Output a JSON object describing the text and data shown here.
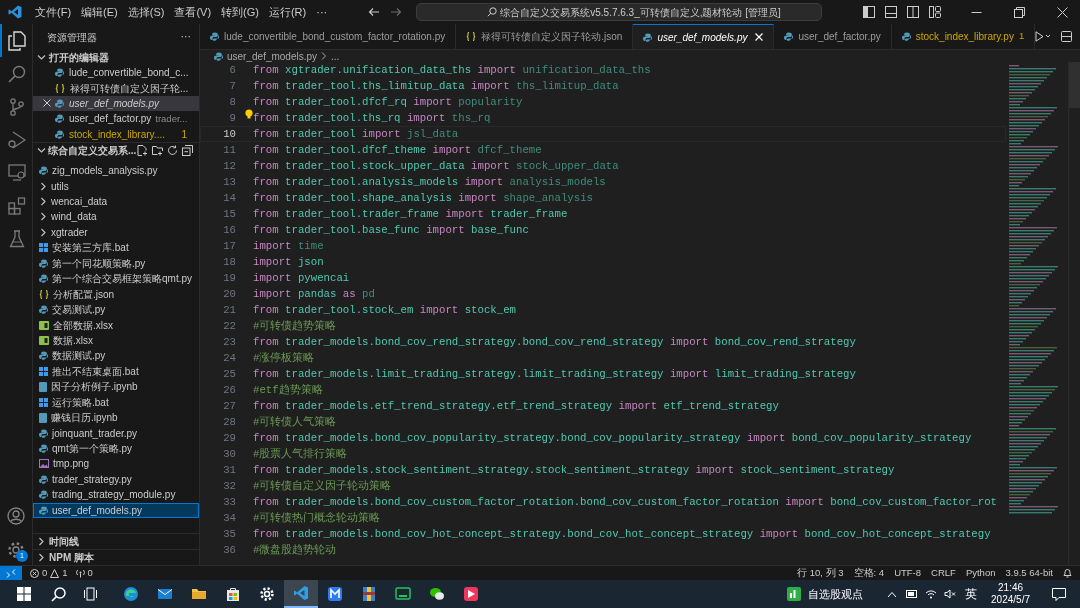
{
  "title_bar": {
    "menus": [
      "文件(F)",
      "编辑(E)",
      "选择(S)",
      "查看(V)",
      "转到(G)",
      "运行(R)",
      "···"
    ],
    "command_center": "综合自定义交易系统v5.5.7.6.3_可转债自定义,题材轮动 [管理员]"
  },
  "activity_bar": {
    "items": [
      {
        "kind": "files",
        "selected": true
      },
      {
        "kind": "search",
        "selected": false
      },
      {
        "kind": "scm",
        "selected": false
      },
      {
        "kind": "debug",
        "selected": false
      },
      {
        "kind": "remote",
        "selected": false
      },
      {
        "kind": "extensions",
        "selected": false
      },
      {
        "kind": "testing",
        "selected": false
      }
    ],
    "settings_badge": "1"
  },
  "sidebar": {
    "title": "资源管理器",
    "more": "···",
    "open_editors": {
      "title": "打开的编辑器",
      "items": [
        {
          "name": "lude_convertible_bond_c...",
          "kind": "py",
          "selected": false,
          "preview": false,
          "warning": false
        },
        {
          "name": "禄得可转债自定义因子轮...",
          "kind": "json",
          "selected": false,
          "preview": false,
          "warning": false
        },
        {
          "name": "user_def_models.py",
          "kind": "py",
          "selected": true,
          "preview": true,
          "warning": false
        },
        {
          "name": "user_def_factor.py",
          "description": "trader...",
          "kind": "py",
          "selected": false,
          "preview": false,
          "warning": false
        },
        {
          "name": "stock_index_library....",
          "problems": "1",
          "kind": "py",
          "selected": false,
          "preview": false,
          "warning": true
        }
      ]
    },
    "folder": {
      "title": "综合自定义交易系...",
      "items": [
        {
          "name": "zig_models_analysis.py",
          "kind": "py",
          "selected": false
        },
        {
          "name": "utils",
          "kind": "folder",
          "selected": false
        },
        {
          "name": "wencai_data",
          "kind": "folder",
          "selected": false
        },
        {
          "name": "wind_data",
          "kind": "folder",
          "selected": false
        },
        {
          "name": "xgtrader",
          "kind": "folder",
          "selected": false
        },
        {
          "name": "安装第三方库.bat",
          "kind": "bat",
          "selected": false
        },
        {
          "name": "第一个同花顺策略.py",
          "kind": "py",
          "selected": false
        },
        {
          "name": "第一个综合交易框架策略qmt.py",
          "kind": "py",
          "selected": false
        },
        {
          "name": "分析配置.json",
          "kind": "json",
          "selected": false
        },
        {
          "name": "交易测试.py",
          "kind": "py",
          "selected": false
        },
        {
          "name": "全部数据.xlsx",
          "kind": "xlsx",
          "selected": false
        },
        {
          "name": "数据.xlsx",
          "kind": "xlsx",
          "selected": false
        },
        {
          "name": "数据测试.py",
          "kind": "py",
          "selected": false
        },
        {
          "name": "推出不结束桌面.bat",
          "kind": "bat",
          "selected": false
        },
        {
          "name": "因子分析例子.ipynb",
          "kind": "ipynb",
          "selected": false
        },
        {
          "name": "运行策略.bat",
          "kind": "bat",
          "selected": false
        },
        {
          "name": "赚钱日历.ipynb",
          "kind": "ipynb",
          "selected": false
        },
        {
          "name": "joinquant_trader.py",
          "kind": "py",
          "selected": false
        },
        {
          "name": "qmt第一个策略.py",
          "kind": "py",
          "selected": false
        },
        {
          "name": "tmp.png",
          "kind": "png",
          "selected": false
        },
        {
          "name": "trader_strategy.py",
          "kind": "py",
          "selected": false
        },
        {
          "name": "trading_strategy_module.py",
          "kind": "py",
          "selected": false
        },
        {
          "name": "user_def_models.py",
          "kind": "py",
          "selected": true
        }
      ]
    },
    "panels": [
      "时间线",
      "NPM 脚本"
    ]
  },
  "tabs": [
    {
      "label": "lude_convertible_bond_custom_factor_rotation.py",
      "kind": "py",
      "selected": false,
      "warning": false
    },
    {
      "label": "禄得可转债自定义因子轮动.json",
      "kind": "json",
      "selected": false,
      "warning": false
    },
    {
      "label": "user_def_models.py",
      "kind": "py",
      "selected": true,
      "warning": false
    },
    {
      "label": "user_def_factor.py",
      "kind": "py",
      "selected": false,
      "warning": false
    },
    {
      "label": "stock_index_library.py",
      "problems": "1",
      "kind": "py",
      "selected": false,
      "warning": true
    }
  ],
  "breadcrumb": [
    "user_def_models.py",
    "..."
  ],
  "code": [
    {
      "number": "6",
      "current": false,
      "lightbulb": false,
      "tokens": [
        {
          "kind": "keyword",
          "text": "from"
        },
        {
          "kind": "module",
          "text": "xgtrader.unification_data_ths"
        },
        {
          "kind": "keyword",
          "text": "import"
        },
        {
          "kind": "unused",
          "text": "unification_data_ths"
        }
      ]
    },
    {
      "number": "7",
      "current": false,
      "lightbulb": false,
      "tokens": [
        {
          "kind": "keyword",
          "text": "from"
        },
        {
          "kind": "module",
          "text": "trader_tool.ths_limitup_data"
        },
        {
          "kind": "keyword",
          "text": "import"
        },
        {
          "kind": "unused",
          "text": "ths_limitup_data"
        }
      ]
    },
    {
      "number": "8",
      "current": false,
      "lightbulb": false,
      "tokens": [
        {
          "kind": "keyword",
          "text": "from"
        },
        {
          "kind": "module",
          "text": "trader_tool.dfcf_rq"
        },
        {
          "kind": "keyword",
          "text": "import"
        },
        {
          "kind": "unused",
          "text": "popularity"
        }
      ]
    },
    {
      "number": "9",
      "current": false,
      "lightbulb": true,
      "tokens": [
        {
          "kind": "keyword",
          "text": "from"
        },
        {
          "kind": "module",
          "text": "trader_tool.ths_rq"
        },
        {
          "kind": "keyword",
          "text": "import"
        },
        {
          "kind": "unused",
          "text": "ths_rq"
        }
      ]
    },
    {
      "number": "10",
      "current": true,
      "lightbulb": false,
      "tokens": [
        {
          "kind": "keyword",
          "text": "from"
        },
        {
          "kind": "module",
          "text": "trader_tool"
        },
        {
          "kind": "keyword",
          "text": "import"
        },
        {
          "kind": "unused",
          "text": "jsl_data"
        }
      ]
    },
    {
      "number": "11",
      "current": false,
      "lightbulb": false,
      "tokens": [
        {
          "kind": "keyword",
          "text": "from"
        },
        {
          "kind": "module",
          "text": "trader_tool.dfcf_theme"
        },
        {
          "kind": "keyword",
          "text": "import"
        },
        {
          "kind": "unused",
          "text": "dfcf_theme"
        }
      ]
    },
    {
      "number": "12",
      "current": false,
      "lightbulb": false,
      "tokens": [
        {
          "kind": "keyword",
          "text": "from"
        },
        {
          "kind": "module",
          "text": "trader_tool.stock_upper_data"
        },
        {
          "kind": "keyword",
          "text": "import"
        },
        {
          "kind": "unused",
          "text": "stock_upper_data"
        }
      ]
    },
    {
      "number": "13",
      "current": false,
      "lightbulb": false,
      "tokens": [
        {
          "kind": "keyword",
          "text": "from"
        },
        {
          "kind": "module",
          "text": "trader_tool.analysis_models"
        },
        {
          "kind": "keyword",
          "text": "import"
        },
        {
          "kind": "unused",
          "text": "analysis_models"
        }
      ]
    },
    {
      "number": "14",
      "current": false,
      "lightbulb": false,
      "tokens": [
        {
          "kind": "keyword",
          "text": "from"
        },
        {
          "kind": "module",
          "text": "trader_tool.shape_analysis"
        },
        {
          "kind": "keyword",
          "text": "import"
        },
        {
          "kind": "unused",
          "text": "shape_analysis"
        }
      ]
    },
    {
      "number": "15",
      "current": false,
      "lightbulb": false,
      "tokens": [
        {
          "kind": "keyword",
          "text": "from"
        },
        {
          "kind": "module",
          "text": "trader_tool.trader_frame"
        },
        {
          "kind": "keyword",
          "text": "import"
        },
        {
          "kind": "module",
          "text": "trader_frame"
        }
      ]
    },
    {
      "number": "16",
      "current": false,
      "lightbulb": false,
      "tokens": [
        {
          "kind": "keyword",
          "text": "from"
        },
        {
          "kind": "module",
          "text": "trader_tool.base_func"
        },
        {
          "kind": "keyword",
          "text": "import"
        },
        {
          "kind": "module",
          "text": "base_func"
        }
      ]
    },
    {
      "number": "17",
      "current": false,
      "lightbulb": false,
      "tokens": [
        {
          "kind": "keyword",
          "text": "import"
        },
        {
          "kind": "unused",
          "text": "time"
        }
      ]
    },
    {
      "number": "18",
      "current": false,
      "lightbulb": false,
      "tokens": [
        {
          "kind": "keyword",
          "text": "import"
        },
        {
          "kind": "module",
          "text": "json"
        }
      ]
    },
    {
      "number": "19",
      "current": false,
      "lightbulb": false,
      "tokens": [
        {
          "kind": "keyword",
          "text": "import"
        },
        {
          "kind": "module",
          "text": "pywencai"
        }
      ]
    },
    {
      "number": "20",
      "current": false,
      "lightbulb": false,
      "tokens": [
        {
          "kind": "keyword",
          "text": "import"
        },
        {
          "kind": "module",
          "text": "pandas"
        },
        {
          "kind": "keyword",
          "text": "as"
        },
        {
          "kind": "unused",
          "text": "pd"
        }
      ]
    },
    {
      "number": "21",
      "current": false,
      "lightbulb": false,
      "tokens": [
        {
          "kind": "keyword",
          "text": "from"
        },
        {
          "kind": "module",
          "text": "trader_tool.stock_em"
        },
        {
          "kind": "keyword",
          "text": "import"
        },
        {
          "kind": "module",
          "text": "stock_em"
        }
      ]
    },
    {
      "number": "22",
      "current": false,
      "lightbulb": false,
      "tokens": [
        {
          "kind": "comment",
          "text": "#可转债趋势策略"
        }
      ]
    },
    {
      "number": "23",
      "current": false,
      "lightbulb": false,
      "tokens": [
        {
          "kind": "keyword",
          "text": "from"
        },
        {
          "kind": "module",
          "text": "trader_models.bond_cov_rend_strategy.bond_cov_rend_strategy"
        },
        {
          "kind": "keyword",
          "text": "import"
        },
        {
          "kind": "module",
          "text": "bond_cov_rend_strategy"
        }
      ]
    },
    {
      "number": "24",
      "current": false,
      "lightbulb": false,
      "tokens": [
        {
          "kind": "comment",
          "text": "#涨停板策略"
        }
      ]
    },
    {
      "number": "25",
      "current": false,
      "lightbulb": false,
      "tokens": [
        {
          "kind": "keyword",
          "text": "from"
        },
        {
          "kind": "module",
          "text": "trader_models.limit_trading_strategy.limit_trading_strategy"
        },
        {
          "kind": "keyword",
          "text": "import"
        },
        {
          "kind": "module",
          "text": "limit_trading_strategy"
        }
      ]
    },
    {
      "number": "26",
      "current": false,
      "lightbulb": false,
      "tokens": [
        {
          "kind": "comment",
          "text": "#etf趋势策略"
        }
      ]
    },
    {
      "number": "27",
      "current": false,
      "lightbulb": false,
      "tokens": [
        {
          "kind": "keyword",
          "text": "from"
        },
        {
          "kind": "module",
          "text": "trader_models.etf_trend_strategy.etf_trend_strategy"
        },
        {
          "kind": "keyword",
          "text": "import"
        },
        {
          "kind": "module",
          "text": "etf_trend_strategy"
        }
      ]
    },
    {
      "number": "28",
      "current": false,
      "lightbulb": false,
      "tokens": [
        {
          "kind": "comment",
          "text": "#可转债人气策略"
        }
      ]
    },
    {
      "number": "29",
      "current": false,
      "lightbulb": false,
      "tokens": [
        {
          "kind": "keyword",
          "text": "from"
        },
        {
          "kind": "module",
          "text": "trader_models.bond_cov_popularity_strategy.bond_cov_popularity_strategy"
        },
        {
          "kind": "keyword",
          "text": "import"
        },
        {
          "kind": "module",
          "text": "bond_cov_popularity_strategy"
        }
      ]
    },
    {
      "number": "30",
      "current": false,
      "lightbulb": false,
      "tokens": [
        {
          "kind": "comment",
          "text": "#股票人气排行策略"
        }
      ]
    },
    {
      "number": "31",
      "current": false,
      "lightbulb": false,
      "tokens": [
        {
          "kind": "keyword",
          "text": "from"
        },
        {
          "kind": "module",
          "text": "trader_models.stock_sentiment_strategy.stock_sentiment_strategy"
        },
        {
          "kind": "keyword",
          "text": "import"
        },
        {
          "kind": "module",
          "text": "stock_sentiment_strategy"
        }
      ]
    },
    {
      "number": "32",
      "current": false,
      "lightbulb": false,
      "tokens": [
        {
          "kind": "comment",
          "text": "#可转债自定义因子轮动策略"
        }
      ]
    },
    {
      "number": "33",
      "current": false,
      "lightbulb": false,
      "tokens": [
        {
          "kind": "keyword",
          "text": "from"
        },
        {
          "kind": "module",
          "text": "trader_models.bond_cov_custom_factor_rotation.bond_cov_custom_factor_rotation"
        },
        {
          "kind": "keyword",
          "text": "import"
        },
        {
          "kind": "module",
          "text": "bond_cov_custom_factor_rot"
        }
      ]
    },
    {
      "number": "34",
      "current": false,
      "lightbulb": false,
      "tokens": [
        {
          "kind": "comment",
          "text": "#可转债热门概念轮动策略"
        }
      ]
    },
    {
      "number": "35",
      "current": false,
      "lightbulb": false,
      "tokens": [
        {
          "kind": "keyword",
          "text": "from"
        },
        {
          "kind": "module",
          "text": "trader_models.bond_cov_hot_concept_strategy.bond_cov_hot_concept_strategy"
        },
        {
          "kind": "keyword",
          "text": "import"
        },
        {
          "kind": "module",
          "text": "bond_cov_hot_concept_strategy"
        }
      ]
    },
    {
      "number": "36",
      "current": false,
      "lightbulb": false,
      "tokens": [
        {
          "kind": "comment",
          "text": "#微盘股趋势轮动"
        }
      ]
    }
  ],
  "status_bar": {
    "errors": "0",
    "warnings": "1",
    "ports": "0",
    "right": [
      "行 10, 列 3",
      "空格: 4",
      "UTF-8",
      "CRLF",
      "Python",
      "3.9.5 64-bit"
    ]
  },
  "taskbar": {
    "apps": [
      {
        "kind": "browser",
        "selected": false
      },
      {
        "kind": "mail",
        "selected": false
      },
      {
        "kind": "folder",
        "selected": false
      },
      {
        "kind": "store",
        "selected": false
      },
      {
        "kind": "settings",
        "selected": false
      },
      {
        "kind": "code",
        "selected": true
      },
      {
        "kind": "m-app",
        "selected": false
      },
      {
        "kind": "archive",
        "selected": false
      },
      {
        "kind": "screen",
        "selected": false
      },
      {
        "kind": "chat",
        "selected": false
      },
      {
        "kind": "pink-app",
        "selected": false
      }
    ],
    "widget": "自选股观点",
    "ime": "英",
    "time": "21:46",
    "date": "2024/5/7"
  }
}
